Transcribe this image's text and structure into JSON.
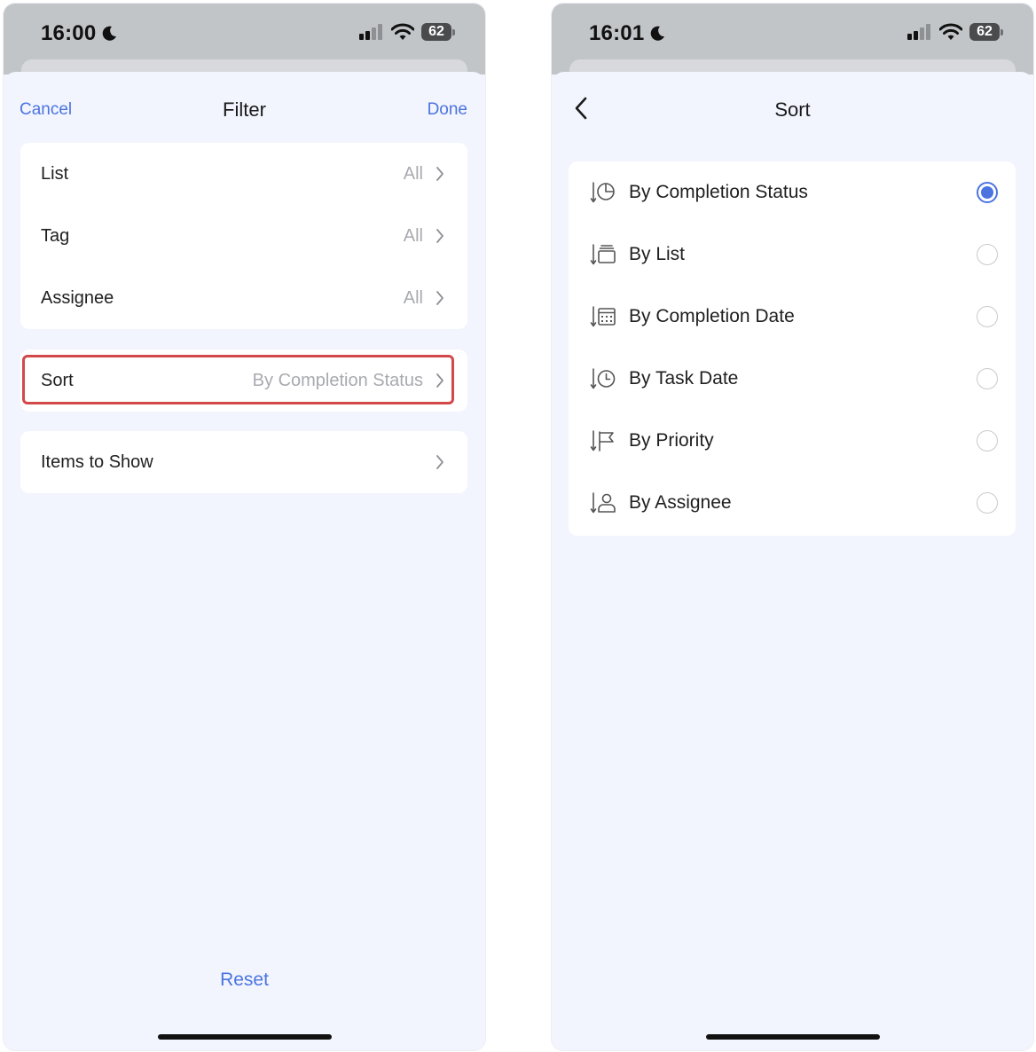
{
  "left_screen": {
    "status": {
      "time": "16:00",
      "battery": "62"
    },
    "nav": {
      "cancel": "Cancel",
      "title": "Filter",
      "done": "Done"
    },
    "filter_rows": [
      {
        "label": "List",
        "value": "All"
      },
      {
        "label": "Tag",
        "value": "All"
      },
      {
        "label": "Assignee",
        "value": "All"
      }
    ],
    "sort_row": {
      "label": "Sort",
      "value": "By Completion Status"
    },
    "items_row": {
      "label": "Items to Show"
    },
    "reset": "Reset"
  },
  "right_screen": {
    "status": {
      "time": "16:01",
      "battery": "62"
    },
    "nav": {
      "title": "Sort"
    },
    "options": [
      {
        "label": "By Completion Status",
        "icon": "completion-status-icon",
        "selected": true
      },
      {
        "label": "By List",
        "icon": "list-icon",
        "selected": false
      },
      {
        "label": "By Completion Date",
        "icon": "calendar-icon",
        "selected": false
      },
      {
        "label": "By Task Date",
        "icon": "clock-icon",
        "selected": false
      },
      {
        "label": "By Priority",
        "icon": "flag-icon",
        "selected": false
      },
      {
        "label": "By Assignee",
        "icon": "person-icon",
        "selected": false
      }
    ]
  },
  "colors": {
    "accent": "#4c74e0",
    "highlight": "#d3494b",
    "background": "#f2f5fe"
  }
}
